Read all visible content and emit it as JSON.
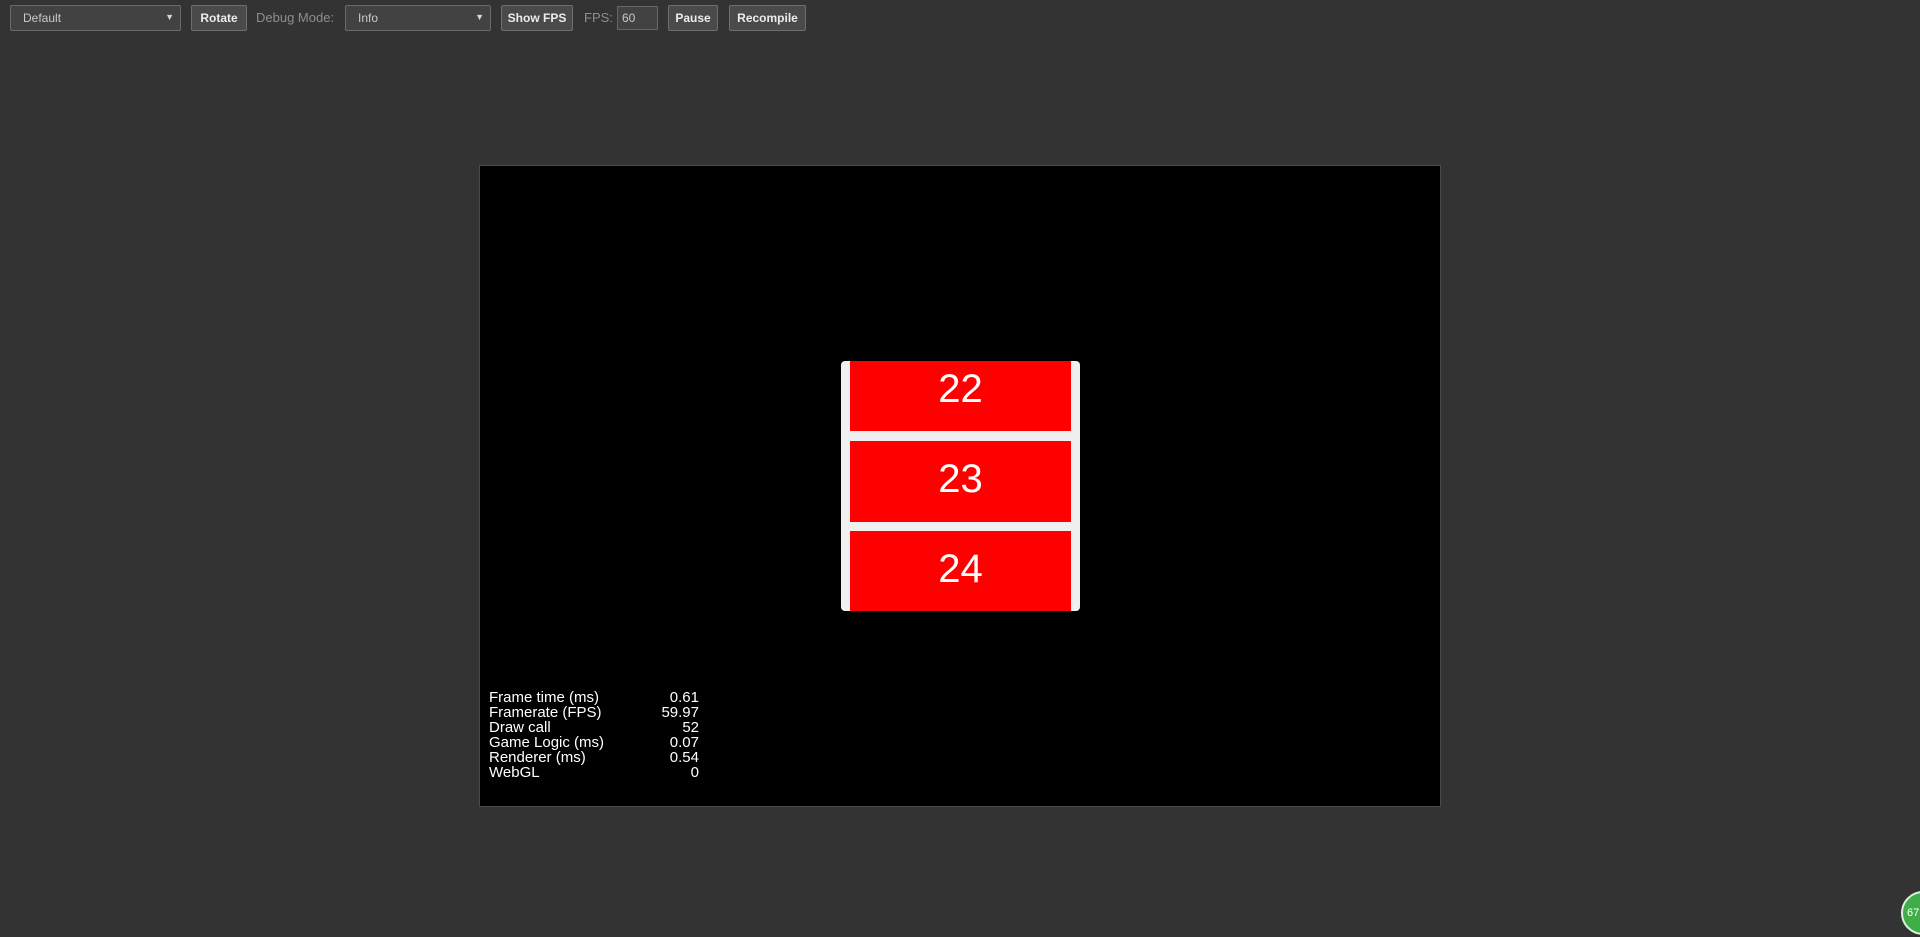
{
  "toolbar": {
    "scene_select": {
      "value": "Default"
    },
    "rotate_label": "Rotate",
    "debug_mode_label": "Debug Mode:",
    "debug_mode_select": {
      "value": "Info"
    },
    "show_fps_label": "Show FPS",
    "fps_label": "FPS:",
    "fps_value": "60",
    "pause_label": "Pause",
    "recompile_label": "Recompile"
  },
  "scroll_view": {
    "cells": [
      {
        "label": "22"
      },
      {
        "label": "23"
      },
      {
        "label": "24"
      }
    ]
  },
  "stats": [
    {
      "key": "Frame time (ms)",
      "value": "0.61"
    },
    {
      "key": "Framerate (FPS)",
      "value": "59.97"
    },
    {
      "key": "Draw call",
      "value": "52"
    },
    {
      "key": "Game Logic (ms)",
      "value": "0.07"
    },
    {
      "key": "Renderer (ms)",
      "value": "0.54"
    },
    {
      "key": "WebGL",
      "value": "0"
    }
  ],
  "fps_indicator": {
    "value": "67"
  },
  "colors": {
    "background": "#333333",
    "stage": "#000000",
    "cell": "#ff0000",
    "scroll_frame": "#f0f0f0",
    "fps_indicator": "#3fae49"
  },
  "icons": {
    "select_arrow": "triangle-down-icon"
  }
}
